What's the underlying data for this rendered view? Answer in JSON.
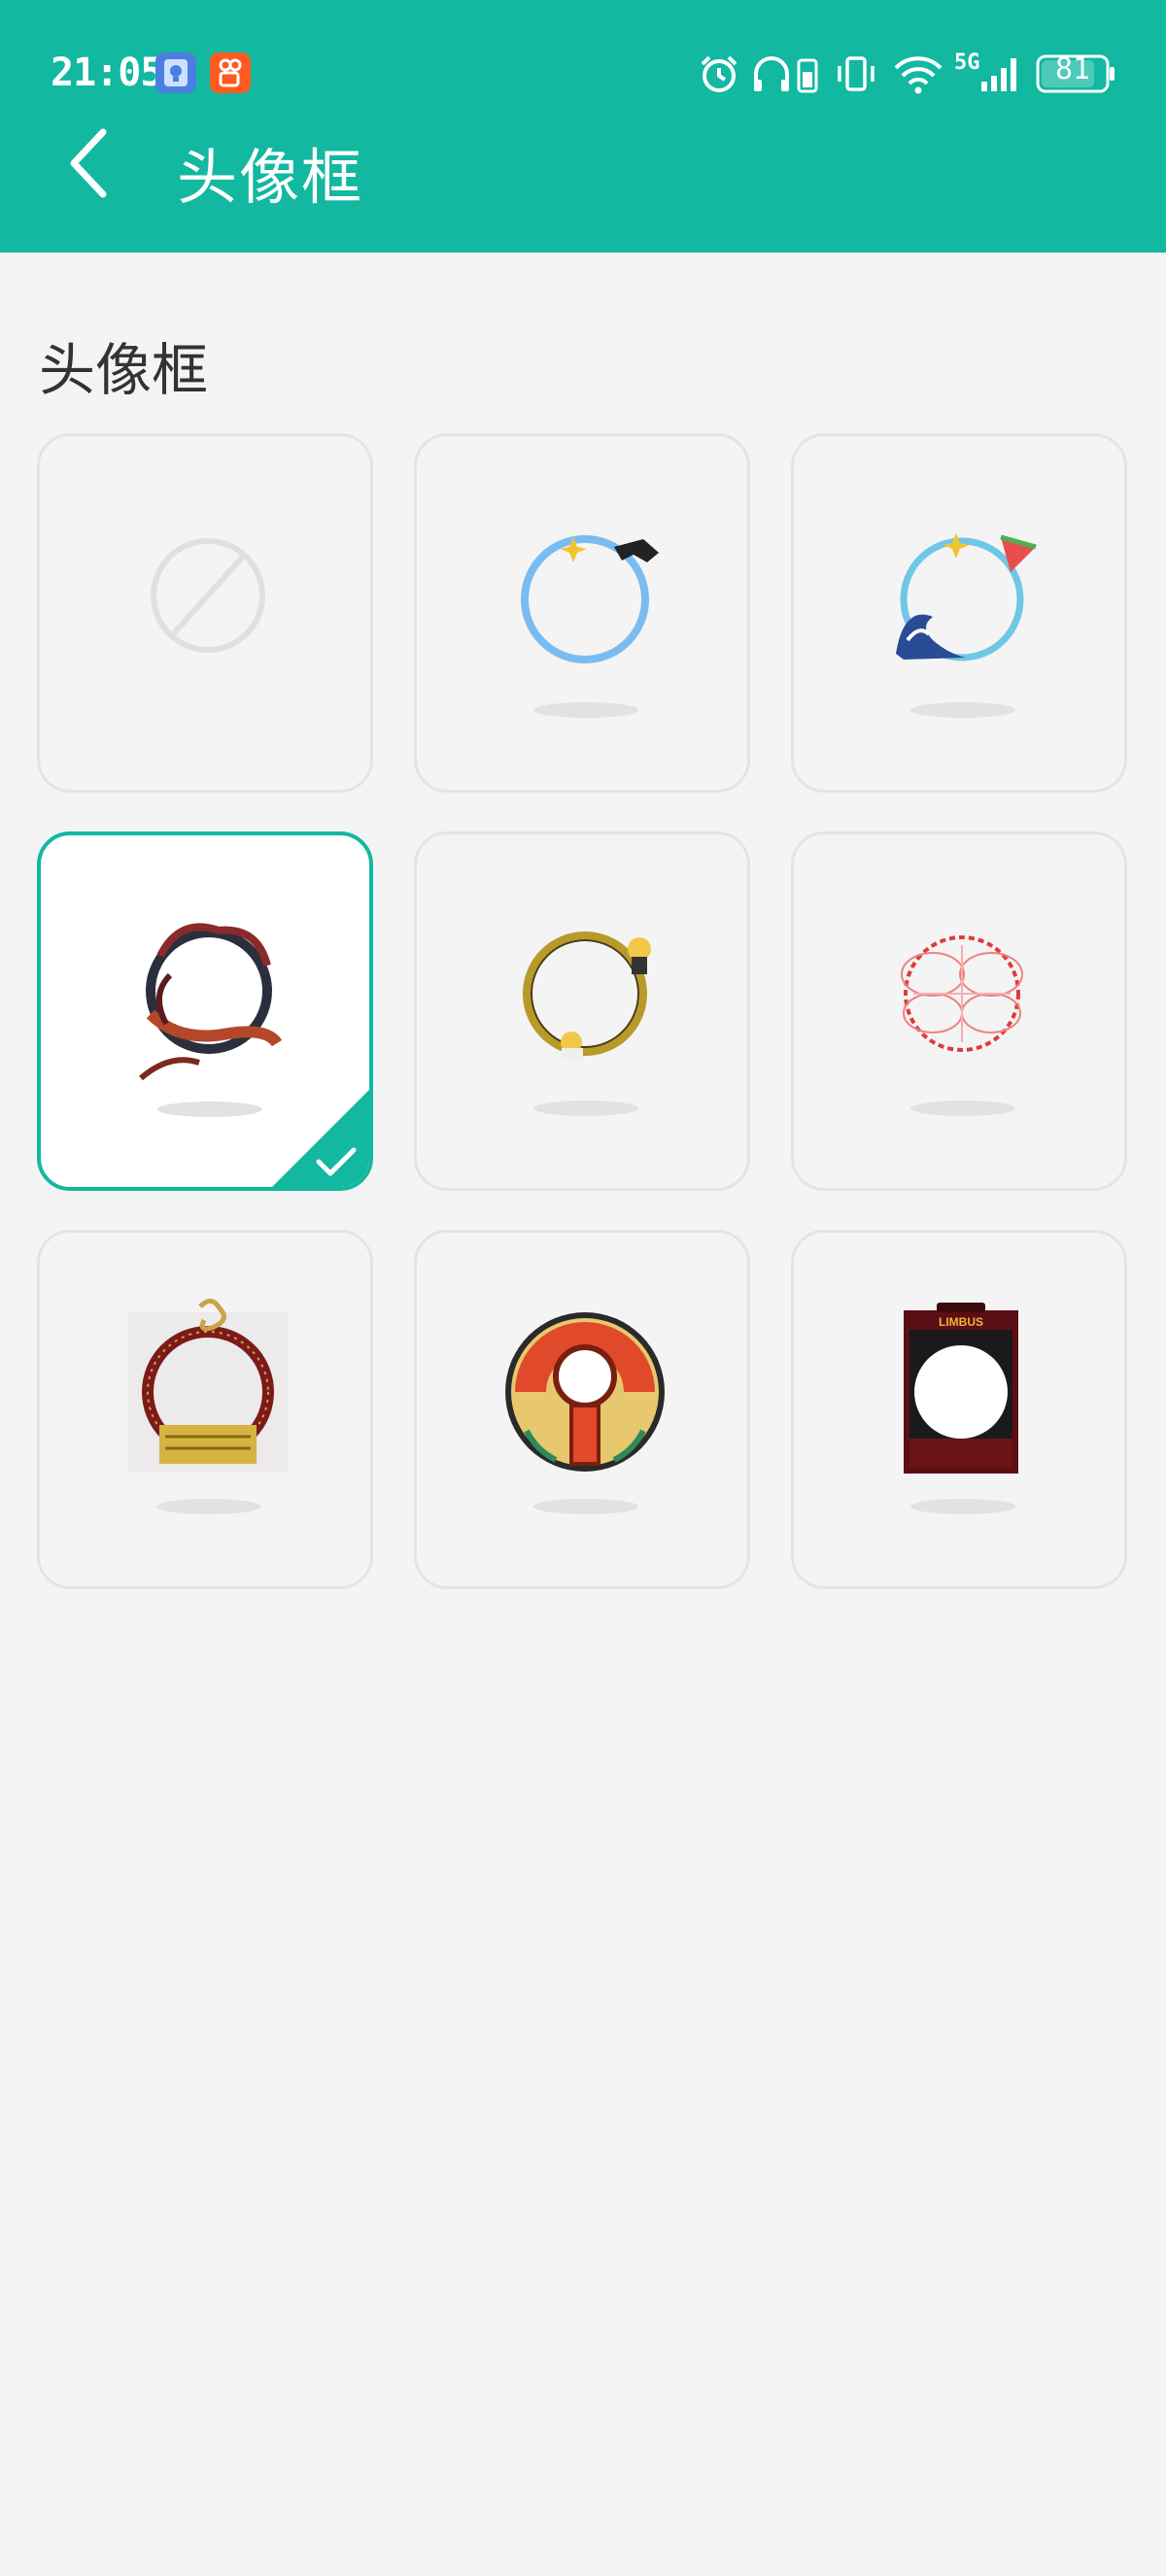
{
  "status_bar": {
    "time": "21:05",
    "network": "5G",
    "battery": "81",
    "icons": [
      "photo-app-icon",
      "kuaishou-app-icon",
      "alarm-icon",
      "headphones-battery-icon",
      "vibrate-icon",
      "wifi-icon",
      "signal-icon",
      "battery-icon"
    ]
  },
  "header": {
    "title": "头像框"
  },
  "section": {
    "title": "头像框"
  },
  "frames": [
    {
      "id": "none",
      "label": "",
      "selected": false
    },
    {
      "id": "sunglasses",
      "label": "",
      "selected": false
    },
    {
      "id": "wave-watermelon",
      "label": "",
      "selected": false
    },
    {
      "id": "dragon",
      "label": "",
      "selected": true
    },
    {
      "id": "gold-anime",
      "label": "",
      "selected": false
    },
    {
      "id": "red-floral",
      "label": "",
      "selected": false
    },
    {
      "id": "jackpot-red",
      "label": "",
      "selected": false
    },
    {
      "id": "orange-emblem",
      "label": "",
      "selected": false
    },
    {
      "id": "limbus-card",
      "label": "LIMBUS",
      "selected": false
    }
  ],
  "colors": {
    "accent": "#12b8a0",
    "background": "#f4f4f4"
  }
}
